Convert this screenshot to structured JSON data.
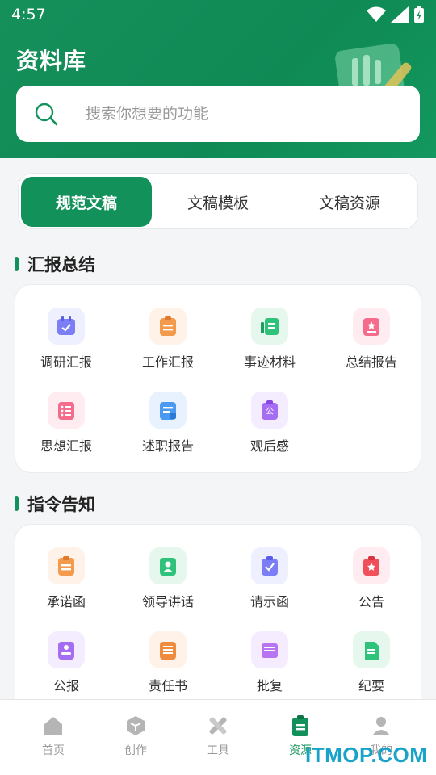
{
  "status_bar": {
    "time": "4:57"
  },
  "page_title": "资料库",
  "search": {
    "placeholder": "搜索你想要的功能"
  },
  "tabs": [
    {
      "label": "规范文稿",
      "active": true
    },
    {
      "label": "文稿模板",
      "active": false
    },
    {
      "label": "文稿资源",
      "active": false
    }
  ],
  "sections": [
    {
      "title": "汇报总结",
      "items": [
        {
          "label": "调研汇报",
          "icon": "calendar-check-icon",
          "color": "#6b6ef5"
        },
        {
          "label": "工作汇报",
          "icon": "clipboard-list-icon",
          "color": "#f08a3c"
        },
        {
          "label": "事迹材料",
          "icon": "chart-doc-icon",
          "color": "#20b36b"
        },
        {
          "label": "总结报告",
          "icon": "star-doc-icon",
          "color": "#f0557a"
        },
        {
          "label": "思想汇报",
          "icon": "list-doc-icon",
          "color": "#f0557a"
        },
        {
          "label": "述职报告",
          "icon": "report-doc-icon",
          "color": "#3a8ff0"
        },
        {
          "label": "观后感",
          "icon": "notice-doc-icon",
          "color": "#9b5cf0"
        }
      ]
    },
    {
      "title": "指令告知",
      "items": [
        {
          "label": "承诺函",
          "icon": "clipboard-list-icon",
          "color": "#f08a3c"
        },
        {
          "label": "领导讲话",
          "icon": "user-card-icon",
          "color": "#20b36b"
        },
        {
          "label": "请示函",
          "icon": "clipboard-check-icon",
          "color": "#6b6ef5"
        },
        {
          "label": "公告",
          "icon": "star-clipboard-icon",
          "color": "#f0557a"
        },
        {
          "label": "公报",
          "icon": "person-doc-icon",
          "color": "#9b5cf0"
        },
        {
          "label": "责任书",
          "icon": "lined-doc-icon",
          "color": "#f08a3c"
        },
        {
          "label": "批复",
          "icon": "tray-doc-icon",
          "color": "#b45cf0"
        },
        {
          "label": "纪要",
          "icon": "note-doc-icon",
          "color": "#20b36b"
        }
      ]
    }
  ],
  "bottom_nav": [
    {
      "label": "首页",
      "icon": "home-icon",
      "active": false
    },
    {
      "label": "创作",
      "icon": "cube-icon",
      "active": false
    },
    {
      "label": "工具",
      "icon": "tools-icon",
      "active": false
    },
    {
      "label": "资源",
      "icon": "clipboard-icon",
      "active": true
    },
    {
      "label": "我的",
      "icon": "person-icon",
      "active": false
    }
  ],
  "watermark": "ITMOP.COM",
  "colors": {
    "brand": "#13915b",
    "inactive": "#999999"
  }
}
